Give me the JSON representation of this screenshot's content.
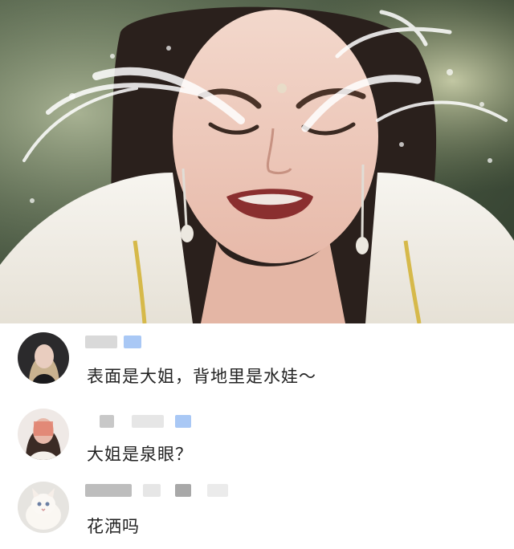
{
  "video": {
    "scene_description_icon": "crying-woman-water-splash"
  },
  "comments": [
    {
      "text": "表面是大姐，背地里是水娃～",
      "avatar_icon": "avatar-portrait-dark"
    },
    {
      "text": "大姐是泉眼？",
      "avatar_icon": "avatar-blurred-face"
    },
    {
      "text": "花洒吗",
      "avatar_icon": "avatar-white-cat"
    }
  ],
  "colors": {
    "text": "#222222",
    "username_blur": "#d9d9d9",
    "badge_blue": "#a9c8f5"
  }
}
